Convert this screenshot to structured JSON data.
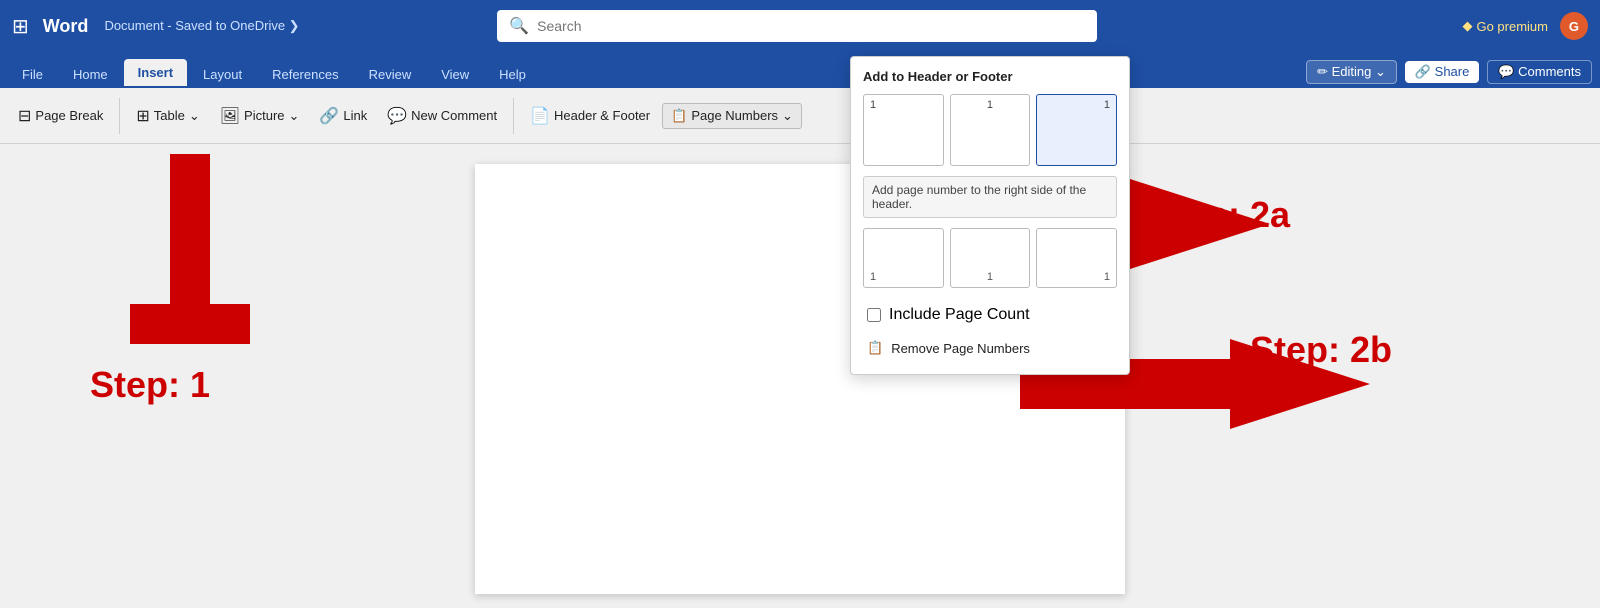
{
  "titlebar": {
    "apps_icon": "⊞",
    "word": "Word",
    "document": "Document - Saved to OneDrive ❯",
    "search_placeholder": "Search",
    "go_premium": "Go premium",
    "avatar": "G"
  },
  "tabs": {
    "items": [
      "File",
      "Home",
      "Insert",
      "Layout",
      "References",
      "Review",
      "View",
      "Help"
    ],
    "active": "Insert",
    "editing_label": "✏ Editing ⌄",
    "share_label": "🔗 Share",
    "comments_label": "💬 Comments"
  },
  "toolbar": {
    "page_break": "Page Break",
    "table": "Table",
    "picture": "Picture",
    "link": "Link",
    "new_comment": "New Comment",
    "header_footer": "Header & Footer",
    "page_numbers": "Page Numbers"
  },
  "dropdown": {
    "title": "Add to Header or Footer",
    "tooltip": "Add page number to the right side of the header.",
    "include_page_count": "Include Page Count",
    "remove_page_numbers": "Remove Page Numbers",
    "rows": [
      [
        {
          "pos": "left",
          "num": "1"
        },
        {
          "pos": "center",
          "num": "1"
        },
        {
          "pos": "right",
          "num": "1"
        }
      ],
      [
        {
          "pos": "left",
          "num": "1"
        },
        {
          "pos": "center",
          "num": "1"
        },
        {
          "pos": "right",
          "num": "1"
        }
      ]
    ]
  },
  "annotations": {
    "step1_label": "Step: 1",
    "step2a_label": "Step: 2a",
    "step2b_label": "Step: 2b"
  }
}
